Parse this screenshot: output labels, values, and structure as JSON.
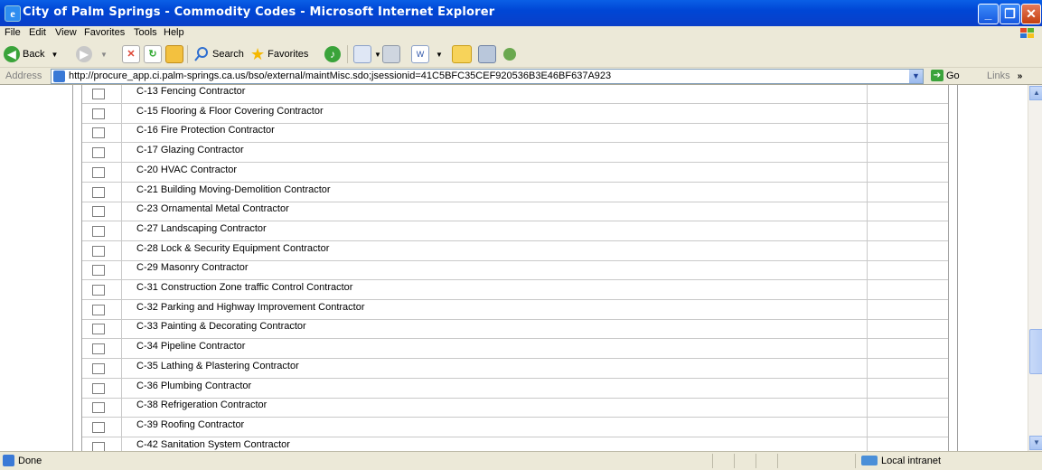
{
  "window": {
    "title": "City of Palm Springs - Commodity Codes - Microsoft Internet Explorer",
    "app_icon": "e"
  },
  "window_buttons": {
    "minimize": "_",
    "maximize": "❐",
    "close": "✕"
  },
  "menu": [
    "File",
    "Edit",
    "View",
    "Favorites",
    "Tools",
    "Help"
  ],
  "toolbar": {
    "back": "Back",
    "search": "Search",
    "favorites": "Favorites"
  },
  "address": {
    "label": "Address",
    "url": "http://procure_app.ci.palm-springs.ca.us/bso/external/maintMisc.sdo;jsessionid=41C5BFC35CEF920536B3E46BF637A923",
    "go": "Go",
    "links": "Links"
  },
  "commodity_codes": [
    "C-13 Fencing Contractor",
    "C-15 Flooring & Floor Covering Contractor",
    "C-16 Fire Protection Contractor",
    "C-17 Glazing Contractor",
    "C-20 HVAC Contractor",
    "C-21 Building Moving-Demolition Contractor",
    "C-23 Ornamental Metal Contractor",
    "C-27 Landscaping Contractor",
    "C-28 Lock & Security Equipment Contractor",
    "C-29 Masonry Contractor",
    "C-31 Construction Zone traffic Control Contractor",
    "C-32 Parking and Highway Improvement Contractor",
    "C-33 Painting & Decorating Contractor",
    "C-34 Pipeline Contractor",
    "C-35 Lathing & Plastering Contractor",
    "C-36 Plumbing Contractor",
    "C-38 Refrigeration Contractor",
    "C-39 Roofing Contractor",
    "C-42 Sanitation System Contractor"
  ],
  "status": {
    "text": "Done",
    "zone": "Local intranet"
  }
}
